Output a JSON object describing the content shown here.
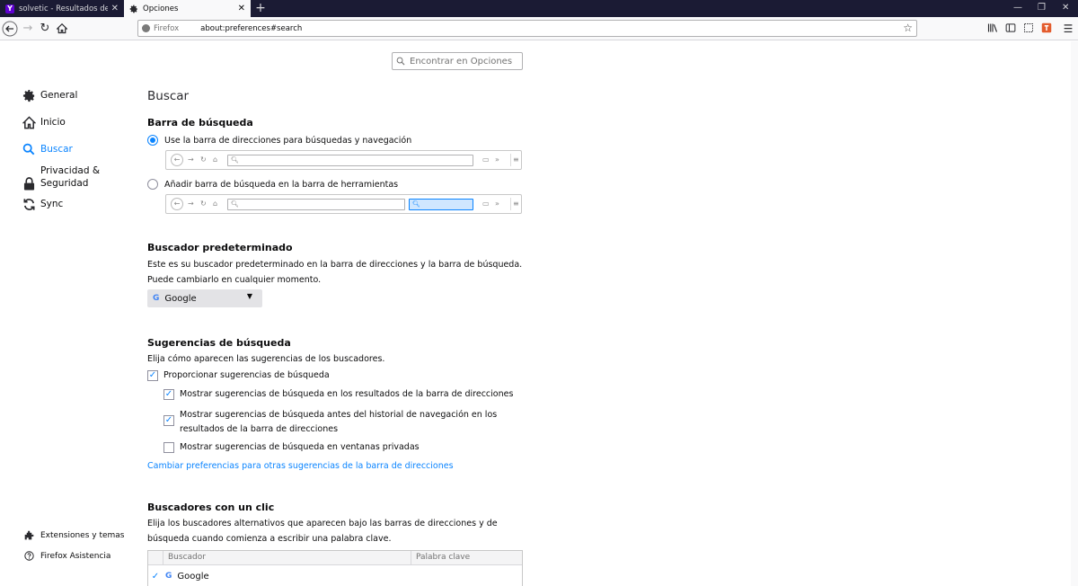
{
  "tabs": [
    {
      "title": "solvetic - Resultados de la búsqueda",
      "close": "✕",
      "favicon": "Y"
    },
    {
      "title": "Opciones",
      "close": "✕"
    }
  ],
  "window_controls": {
    "minimize": "—",
    "restore": "❐",
    "close": "✕"
  },
  "navbar": {
    "identity_label": "Firefox",
    "url": "about:preferences#search"
  },
  "search_options_placeholder": "Encontrar en Opciones",
  "sidebar": {
    "items": [
      {
        "label": "General"
      },
      {
        "label": "Inicio"
      },
      {
        "label": "Buscar"
      },
      {
        "label": "Privacidad & Seguridad"
      },
      {
        "label": "Sync"
      }
    ],
    "footer": [
      {
        "label": "Extensiones y temas"
      },
      {
        "label": "Firefox Asistencia"
      }
    ]
  },
  "page": {
    "title": "Buscar",
    "search_bar": {
      "heading": "Barra de búsqueda",
      "option_urlbar": "Use la barra de direcciones para búsquedas y navegación",
      "option_searchbar": "Añadir barra de búsqueda en la barra de herramientas",
      "selected": "urlbar"
    },
    "default_engine": {
      "heading": "Buscador predeterminado",
      "description": "Este es su buscador predeterminado en la barra de direcciones y la barra de búsqueda. Puede cambiarlo en cualquier momento.",
      "selected_engine": "Google",
      "engine_logo": "G"
    },
    "suggestions": {
      "heading": "Sugerencias de búsqueda",
      "description": "Elija cómo aparecen las sugerencias de los buscadores.",
      "provide": {
        "label": "Proporcionar sugerencias de búsqueda",
        "checked": true
      },
      "in_urlbar": {
        "label": "Mostrar sugerencias de búsqueda en los resultados de la barra de direcciones",
        "checked": true
      },
      "before_history": {
        "label": "Mostrar sugerencias de búsqueda antes del historial de navegación en los resultados de la barra de direcciones",
        "checked": true
      },
      "private": {
        "label": "Mostrar sugerencias de búsqueda en ventanas privadas",
        "checked": false
      },
      "link": "Cambiar preferencias para otras sugerencias de la barra de direcciones"
    },
    "one_click": {
      "heading": "Buscadores con un clic",
      "description": "Elija los buscadores alternativos que aparecen bajo las barras de direcciones y de búsqueda cuando comienza a escribir una palabra clave.",
      "columns": [
        "Buscador",
        "Palabra clave"
      ],
      "rows": [
        {
          "engine": "Google",
          "keyword": "",
          "checked": true,
          "logo": "G"
        }
      ]
    }
  },
  "colors": {
    "accent": "#0a84ff",
    "tabbar": "#1b1b34"
  }
}
